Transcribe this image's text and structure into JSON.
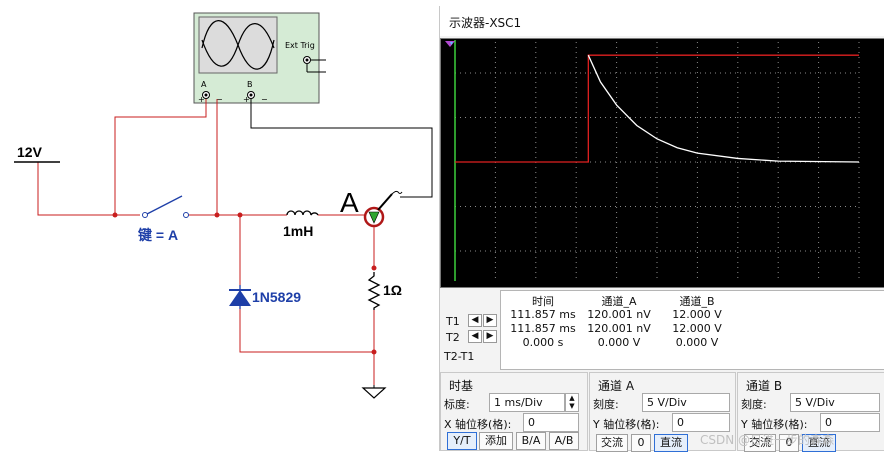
{
  "schematic": {
    "battery_label": "12V",
    "switch_label": "键 = A",
    "inductor_label": "1mH",
    "diode_label": "1N5829",
    "resistor_label": "1Ω",
    "probe_label": "A",
    "scope_terminal_a": "A",
    "scope_terminal_b": "B",
    "ext_trig_label": "Ext Trig"
  },
  "scope_window": {
    "title": "示波器-XSC1"
  },
  "chart_data": {
    "type": "line",
    "series": [
      {
        "name": "通道_A",
        "color": "#e02020",
        "x": [
          0,
          3.3,
          3.3,
          10
        ],
        "y": [
          0,
          0,
          12,
          12
        ]
      },
      {
        "name": "通道_B",
        "color": "#ffffff",
        "x": [
          3.3,
          3.6,
          4.0,
          4.5,
          5.0,
          5.5,
          6.0,
          7.0,
          8.0,
          10.0
        ],
        "y": [
          12,
          9.0,
          6.4,
          4.1,
          2.6,
          1.6,
          1.0,
          0.4,
          0.1,
          0
        ]
      }
    ]
  },
  "readout": {
    "t1_label": "T1",
    "t2_label": "T2",
    "t2t1_label": "T2-T1",
    "headers": [
      "时间",
      "通道_A",
      "通道_B"
    ],
    "rows": [
      [
        "111.857 ms",
        "120.001 nV",
        "12.000 V"
      ],
      [
        "111.857 ms",
        "120.001 nV",
        "12.000 V"
      ],
      [
        "0.000 s",
        "0.000 V",
        "0.000 V"
      ]
    ]
  },
  "timebase": {
    "title": "时基",
    "scale_label": "标度:",
    "scale_value": "1 ms/Div",
    "xpos_label": "X 轴位移(格):",
    "xpos_value": "0",
    "buttons": [
      "Y/T",
      "添加",
      "B/A",
      "A/B"
    ]
  },
  "channel_a": {
    "title": "通道 A",
    "scale_label": "刻度:",
    "scale_value": "5  V/Div",
    "ypos_label": "Y 轴位移(格):",
    "ypos_value": "0",
    "buttons": [
      "交流",
      "0",
      "直流"
    ]
  },
  "channel_b": {
    "title": "通道 B",
    "scale_label": "刻度:",
    "scale_value": "5  V/Div",
    "ypos_label": "Y 轴位移(格):",
    "ypos_value": "0",
    "buttons": [
      "交流",
      "0",
      "直流"
    ]
  },
  "watermark": "CSDN @日进一步的森森"
}
